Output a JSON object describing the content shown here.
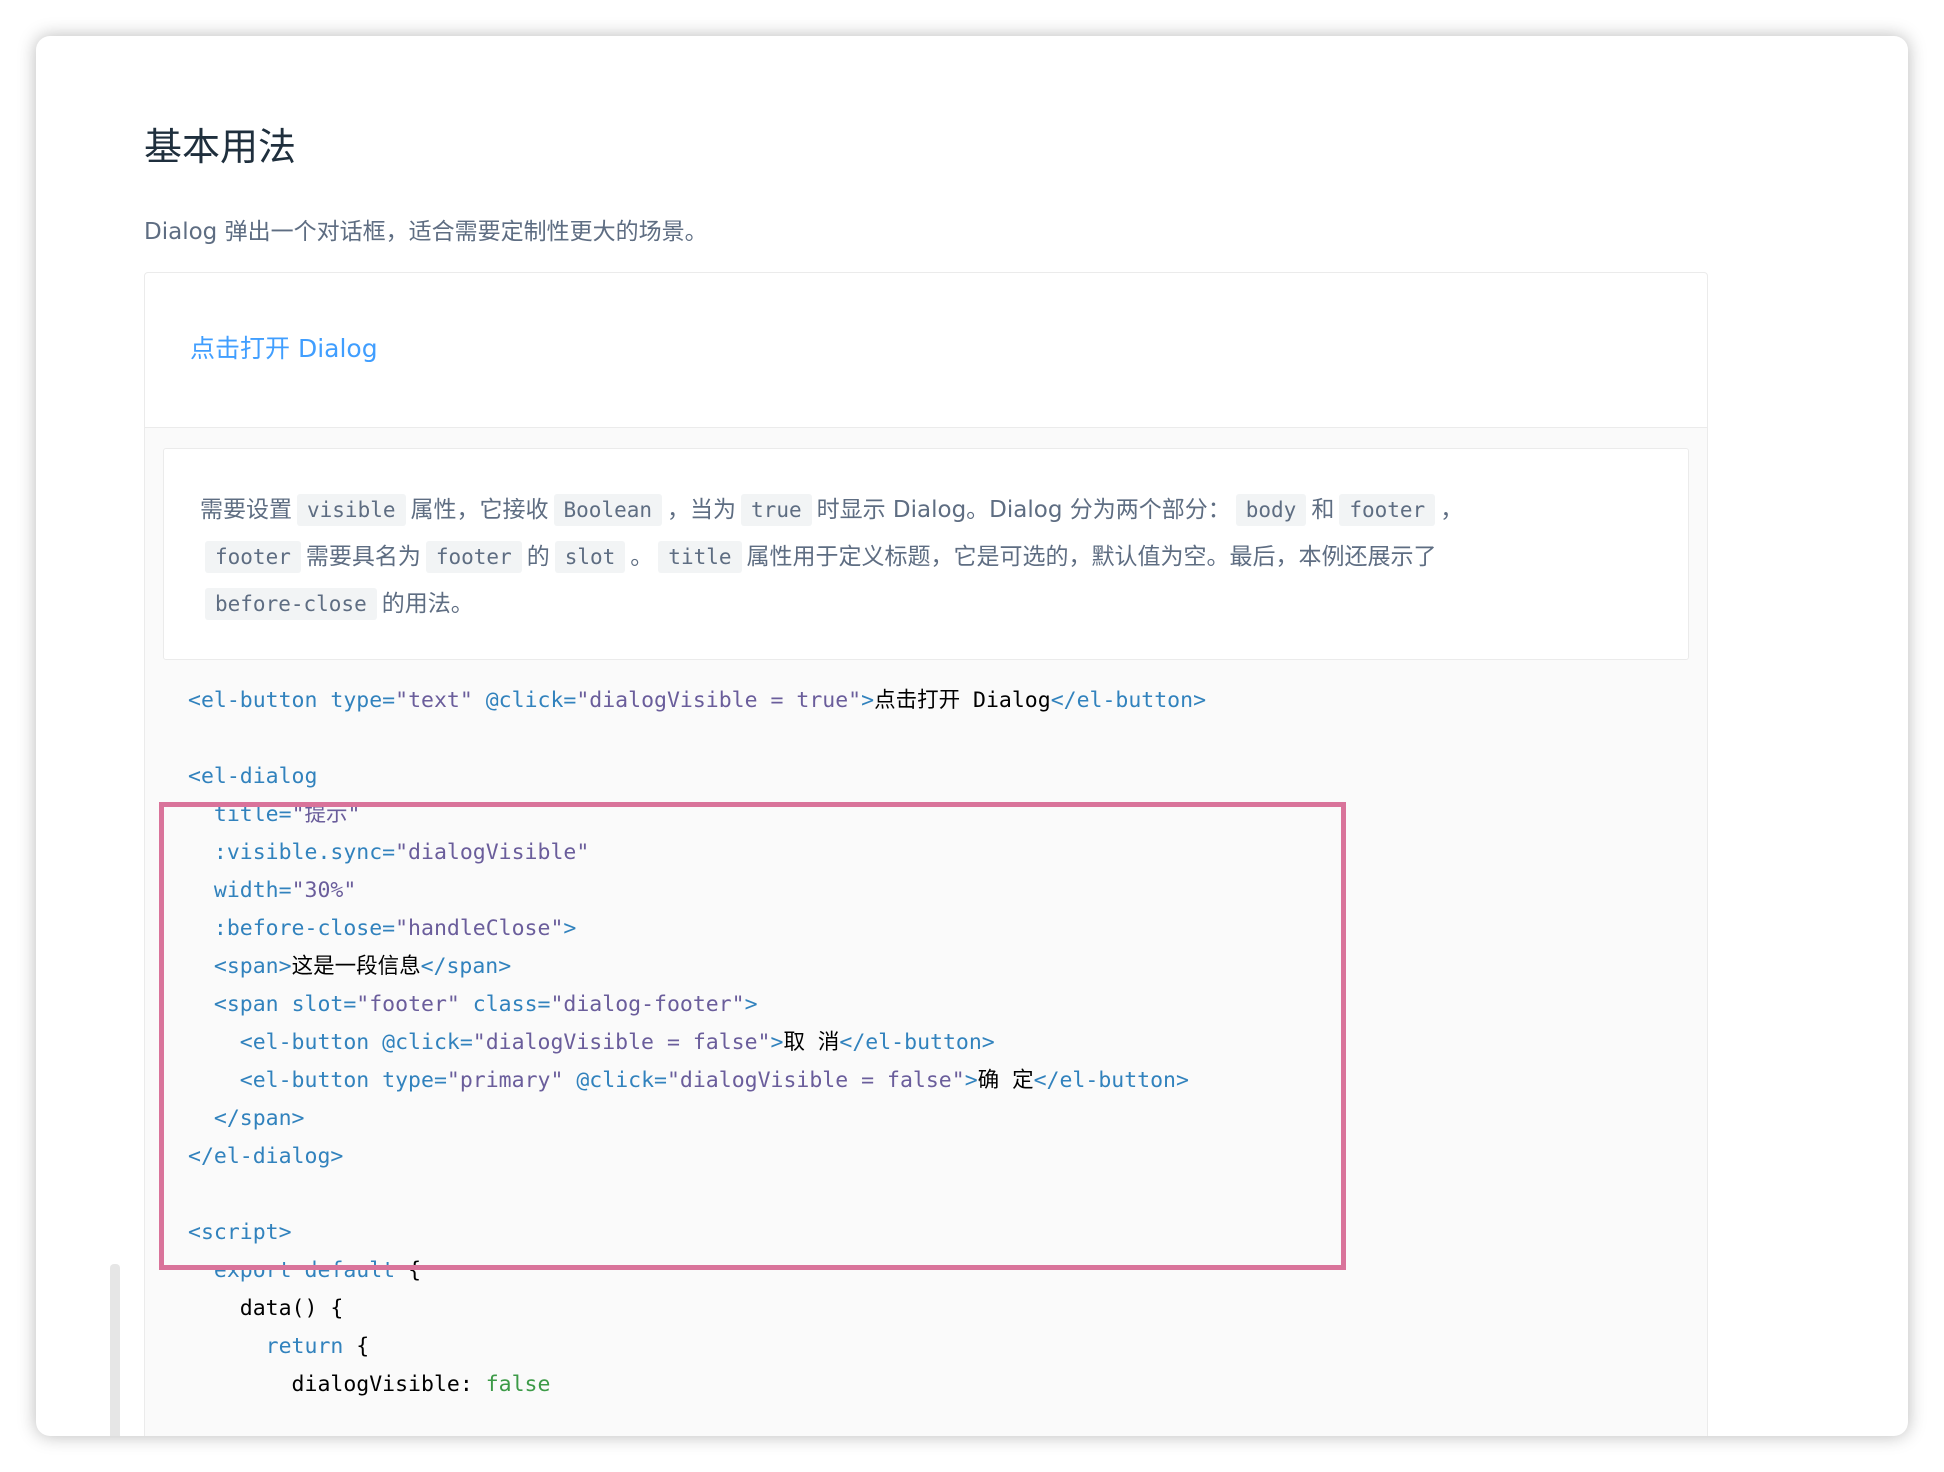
{
  "title": "基本用法",
  "description": "Dialog 弹出一个对话框，适合需要定制性更大的场景。",
  "demo": {
    "button_label": "点击打开 Dialog"
  },
  "explanation": {
    "p1": "需要设置",
    "c1": "visible",
    "p2": "属性，它接收",
    "c2": "Boolean",
    "p3": "，当为",
    "c3": "true",
    "p4": "时显示 Dialog。Dialog 分为两个部分：",
    "c4": "body",
    "p5": "和",
    "c5": "footer",
    "p6": "，",
    "c6": "footer",
    "p7": "需要具名为",
    "c7": "footer",
    "p8": "的",
    "c8": "slot",
    "p9": "。",
    "c9": "title",
    "p10": "属性用于定义标题，它是可选的，默认值为空。最后，本例还展示了",
    "c10": "before-close",
    "p11": "的用法。"
  },
  "code_lines": [
    [
      {
        "t": "tag",
        "v": "<el-button "
      },
      {
        "t": "attr",
        "v": "type="
      },
      {
        "t": "str",
        "v": "\"text\" "
      },
      {
        "t": "attr",
        "v": "@click="
      },
      {
        "t": "str",
        "v": "\"dialogVisible = true\""
      },
      {
        "t": "tag",
        "v": ">"
      },
      {
        "t": "txt",
        "v": "点击打开 Dialog"
      },
      {
        "t": "tag",
        "v": "</el-button>"
      }
    ],
    [],
    [
      {
        "t": "tag",
        "v": "<el-dialog"
      }
    ],
    [
      {
        "t": "attr",
        "v": "  title="
      },
      {
        "t": "str",
        "v": "\"提示\""
      }
    ],
    [
      {
        "t": "attr",
        "v": "  :visible.sync="
      },
      {
        "t": "str",
        "v": "\"dialogVisible\""
      }
    ],
    [
      {
        "t": "attr",
        "v": "  width="
      },
      {
        "t": "str",
        "v": "\"30%\""
      }
    ],
    [
      {
        "t": "attr",
        "v": "  :before-close="
      },
      {
        "t": "str",
        "v": "\"handleClose\""
      },
      {
        "t": "tag",
        "v": ">"
      }
    ],
    [
      {
        "t": "tag",
        "v": "  <span>"
      },
      {
        "t": "txt",
        "v": "这是一段信息"
      },
      {
        "t": "tag",
        "v": "</span>"
      }
    ],
    [
      {
        "t": "tag",
        "v": "  <span "
      },
      {
        "t": "attr",
        "v": "slot="
      },
      {
        "t": "str",
        "v": "\"footer\" "
      },
      {
        "t": "attr",
        "v": "class="
      },
      {
        "t": "str",
        "v": "\"dialog-footer\""
      },
      {
        "t": "tag",
        "v": ">"
      }
    ],
    [
      {
        "t": "tag",
        "v": "    <el-button "
      },
      {
        "t": "attr",
        "v": "@click="
      },
      {
        "t": "str",
        "v": "\"dialogVisible = false\""
      },
      {
        "t": "tag",
        "v": ">"
      },
      {
        "t": "txt",
        "v": "取 消"
      },
      {
        "t": "tag",
        "v": "</el-button>"
      }
    ],
    [
      {
        "t": "tag",
        "v": "    <el-button "
      },
      {
        "t": "attr",
        "v": "type="
      },
      {
        "t": "str",
        "v": "\"primary\" "
      },
      {
        "t": "attr",
        "v": "@click="
      },
      {
        "t": "str",
        "v": "\"dialogVisible = false\""
      },
      {
        "t": "tag",
        "v": ">"
      },
      {
        "t": "txt",
        "v": "确 定"
      },
      {
        "t": "tag",
        "v": "</el-button>"
      }
    ],
    [
      {
        "t": "tag",
        "v": "  </span>"
      }
    ],
    [
      {
        "t": "tag",
        "v": "</el-dialog>"
      }
    ],
    [],
    [
      {
        "t": "tag",
        "v": "<script>"
      }
    ],
    [
      {
        "t": "kw",
        "v": "  export default "
      },
      {
        "t": "txt",
        "v": "{"
      }
    ],
    [
      {
        "t": "txt",
        "v": "    data() {"
      }
    ],
    [
      {
        "t": "kw",
        "v": "      return "
      },
      {
        "t": "txt",
        "v": "{"
      }
    ],
    [
      {
        "t": "txt",
        "v": "        dialogVisible: "
      },
      {
        "t": "bool",
        "v": "false"
      }
    ]
  ],
  "colors": {
    "link": "#409eff",
    "highlight_border": "#d9739a",
    "code_tag": "#3182bd",
    "code_string": "#6a5d9b",
    "code_boolean": "#3c9a47"
  }
}
